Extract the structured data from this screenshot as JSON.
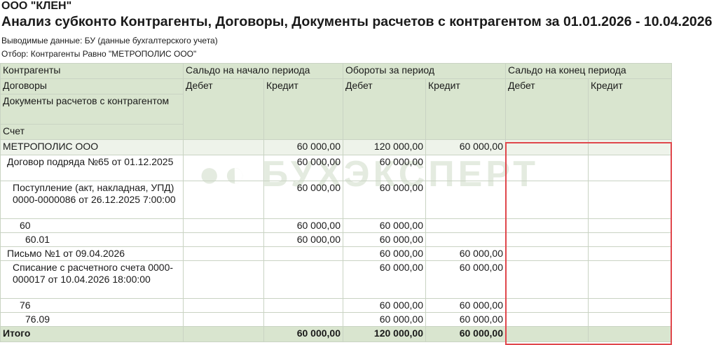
{
  "header": {
    "org": "ООО \"КЛЕН\"",
    "title": "Анализ субконто Контрагенты, Договоры, Документы расчетов с контрагентом за 01.01.2026 - 10.04.2026",
    "data_shown": "Выводимые данные: БУ (данные бухгалтерского учета)",
    "filter": "Отбор: Контрагенты Равно \"МЕТРОПОЛИС ООО\""
  },
  "watermark": "БУХЭКСПЕРТ",
  "columns": {
    "dim1": "Контрагенты",
    "dim2": "Договоры",
    "dim3": "Документы расчетов с контрагентом",
    "dim4": "Счет",
    "open": "Сальдо на начало периода",
    "turn": "Обороты за период",
    "close": "Сальдо на конец периода",
    "debit": "Дебет",
    "credit": "Кредит"
  },
  "rows": [
    {
      "name": "МЕТРОПОЛИС ООО",
      "open_d": "",
      "open_c": "60 000,00",
      "turn_d": "120 000,00",
      "turn_c": "60 000,00",
      "close_d": "",
      "close_c": ""
    },
    {
      "name": "Договор подряда №65 от 01.12.2025",
      "open_d": "",
      "open_c": "60 000,00",
      "turn_d": "60 000,00",
      "turn_c": "",
      "close_d": "",
      "close_c": ""
    },
    {
      "name": "Поступление (акт, накладная, УПД) 0000-0000086 от 26.12.2025 7:00:00",
      "open_d": "",
      "open_c": "60 000,00",
      "turn_d": "60 000,00",
      "turn_c": "",
      "close_d": "",
      "close_c": ""
    },
    {
      "name": "60",
      "open_d": "",
      "open_c": "60 000,00",
      "turn_d": "60 000,00",
      "turn_c": "",
      "close_d": "",
      "close_c": ""
    },
    {
      "name": "60.01",
      "open_d": "",
      "open_c": "60 000,00",
      "turn_d": "60 000,00",
      "turn_c": "",
      "close_d": "",
      "close_c": ""
    },
    {
      "name": "Письмо №1 от 09.04.2026",
      "open_d": "",
      "open_c": "",
      "turn_d": "60 000,00",
      "turn_c": "60 000,00",
      "close_d": "",
      "close_c": ""
    },
    {
      "name": "Списание с расчетного счета 0000-000017 от 10.04.2026 18:00:00",
      "open_d": "",
      "open_c": "",
      "turn_d": "60 000,00",
      "turn_c": "60 000,00",
      "close_d": "",
      "close_c": ""
    },
    {
      "name": "76",
      "open_d": "",
      "open_c": "",
      "turn_d": "60 000,00",
      "turn_c": "60 000,00",
      "close_d": "",
      "close_c": ""
    },
    {
      "name": "76.09",
      "open_d": "",
      "open_c": "",
      "turn_d": "60 000,00",
      "turn_c": "60 000,00",
      "close_d": "",
      "close_c": ""
    }
  ],
  "total": {
    "name": "Итого",
    "open_d": "",
    "open_c": "60 000,00",
    "turn_d": "120 000,00",
    "turn_c": "60 000,00",
    "close_d": "",
    "close_c": ""
  },
  "highlight_color": "#e0474c"
}
